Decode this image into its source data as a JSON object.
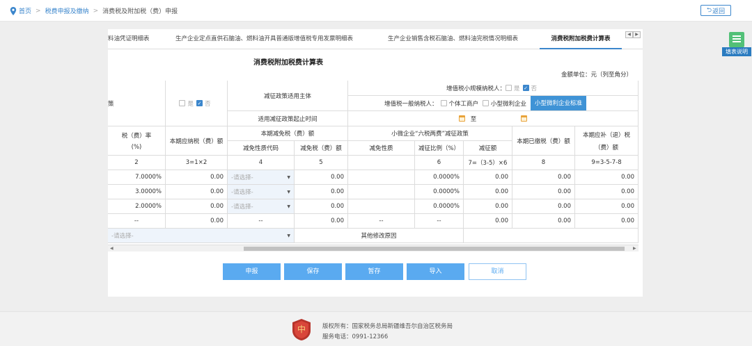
{
  "breadcrumb": {
    "home": "首页",
    "section": "税费申报及缴纳",
    "current": "消费税及附加税（费）申报"
  },
  "back_label": "返回",
  "tabs": [
    "料油凭证明细表",
    "生产企业定点直供石脑油、燃料油开具普通版增值税专用发票明细表",
    "生产企业销售含税石脑油、燃料油完税情况明细表",
    "消费税附加税费计算表"
  ],
  "form": {
    "title": "消费税附加税费计算表",
    "unit": "金额单位：元（列至角分）",
    "left_head_fragment": "策",
    "yes": "是",
    "no": "否",
    "policy_subject": "减征政策适用主体",
    "small_scale": "增值税小规模纳税人：",
    "general_taxpayer": "增值税一般纳税人：",
    "individual": "个体工商户",
    "small_micro": "小型微利企业",
    "standard_btn": "小型微利企业标准",
    "period_label": "适用减征政策起止时间",
    "to": "至",
    "placeholder": "-请选择-",
    "other_reason": "其他修改原因"
  },
  "headers": {
    "rate": "税（费）率",
    "rate_unit": "(%)",
    "payable": "本期应纳税（费）额",
    "exempt": "本期减免税（费）额",
    "exempt_code": "减免性质代码",
    "exempt_amount": "减免税（费）额",
    "sixtax": "小微企业“六税两费”减征政策",
    "nature": "减免性质",
    "ratio": "减征比例（%）",
    "reduce_amount": "减征额",
    "paid": "本期已缴税（费）额",
    "refund": "本期应补（退）税",
    "refund2": "（费）额"
  },
  "formula_row": [
    "2",
    "3=1×2",
    "4",
    "5",
    "",
    "6",
    "7=（3-5）×6",
    "8",
    "9=3-5-7-8"
  ],
  "rows": [
    {
      "rate": "7.0000%",
      "payable": "0.00",
      "code": "-请选择-",
      "exempt": "0.00",
      "nature": "",
      "ratio": "0.0000%",
      "reduce": "0.00",
      "paid": "0.00",
      "refund": "0.00"
    },
    {
      "rate": "3.0000%",
      "payable": "0.00",
      "code": "-请选择-",
      "exempt": "0.00",
      "nature": "",
      "ratio": "0.0000%",
      "reduce": "0.00",
      "paid": "0.00",
      "refund": "0.00"
    },
    {
      "rate": "2.0000%",
      "payable": "0.00",
      "code": "-请选择-",
      "exempt": "0.00",
      "nature": "",
      "ratio": "0.0000%",
      "reduce": "0.00",
      "paid": "0.00",
      "refund": "0.00"
    },
    {
      "rate": "--",
      "payable": "0.00",
      "code": "--",
      "exempt": "0.00",
      "nature": "--",
      "ratio": "--",
      "reduce": "0.00",
      "paid": "0.00",
      "refund": "0.00"
    }
  ],
  "buttons": {
    "declare": "申报",
    "save": "保存",
    "draft": "暂存",
    "import": "导入",
    "cancel": "取消"
  },
  "help_label": "填表说明",
  "footer": {
    "copyright": "版权所有：国家税务总局新疆维吾尔自治区税务局",
    "phone": "服务电话：0991-12366"
  },
  "colors": {
    "accent": "#3b86cc",
    "button": "#5aaaf0",
    "selected_tab_underline": "#3b86cc"
  }
}
